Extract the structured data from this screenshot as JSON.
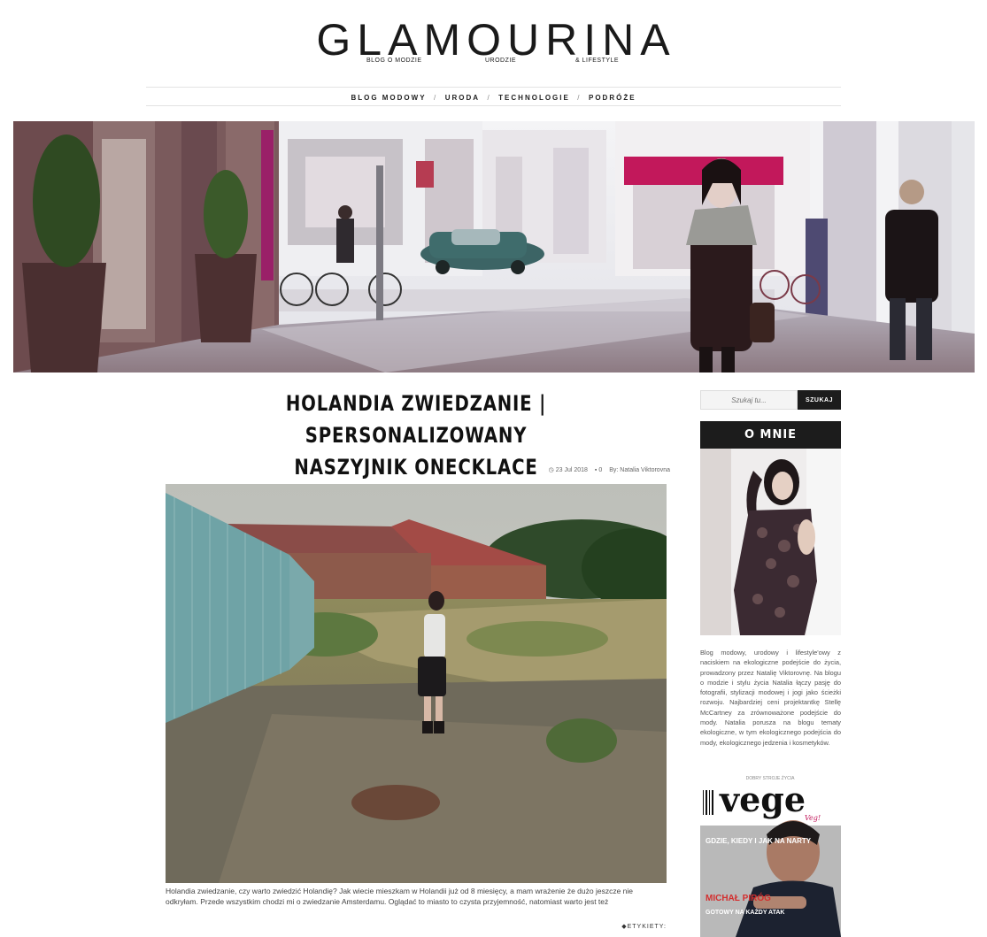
{
  "header": {
    "logo": "GLAMOURINA",
    "tagline": [
      "BLOG O MODZIE",
      "URODZIE",
      "& LIFESTYLE"
    ]
  },
  "nav": {
    "items": [
      "BLOG MODOWY",
      "URODA",
      "TECHNOLOGIE",
      "PODRÓŻE"
    ],
    "separator": "/"
  },
  "post": {
    "title_line1": "HOLANDIA ZWIEDZANIE | SPERSONALIZOWANY",
    "title_line2": "NASZYJNIK ONECKLACE",
    "date": "23 Jul 2018",
    "comments": "0",
    "author": "By: Natalia Viktorovna",
    "excerpt": "Holandia zwiedzanie, czy warto zwiedzić Holandię? Jak wiecie mieszkam w Holandii już od 8 miesięcy, a mam wrażenie że dużo jeszcze nie odkryłam. Przede wszystkim chodzi mi o zwiedzanie Amsterdamu. Oglądać to miasto to czysta przyjemność, natomiast warto jest też",
    "labels": "ETYKIETY:"
  },
  "sidebar": {
    "search_placeholder": "Szukaj tu...",
    "search_button": "SZUKAJ",
    "about_title": "O MNIE",
    "about_text": "Blog modowy, urodowy i lifestyle'owy z naciskiem na ekologiczne podejście do życia, prowadzony przez Natalię Viktorovnę. Na blogu o modzie i stylu życia Natalia łączy pasję do fotografii, stylizacji modowej i jogi jako ścieżki rozwoju. Najbardziej ceni projektantkę Stellę McCartney za zrównoważone podejście do mody. Natalia porusza na blogu tematy ekologiczne, w tym ekologicznego podejścia do mody, ekologicznego jedzenia i kosmetyków.",
    "magazine": {
      "tagline": "DOBRY STROJE ŻYCIA",
      "title": "vege",
      "subtitle": "Veg!",
      "headline1": "GDZIE, KIEDY I JAK NA NARTY",
      "name": "MICHAŁ PIRÓG",
      "headline2": "GOTOWY NA KAŻDY ATAK"
    }
  },
  "colors": {
    "dark": "#1c1c1c",
    "awning": "#c2185b"
  }
}
